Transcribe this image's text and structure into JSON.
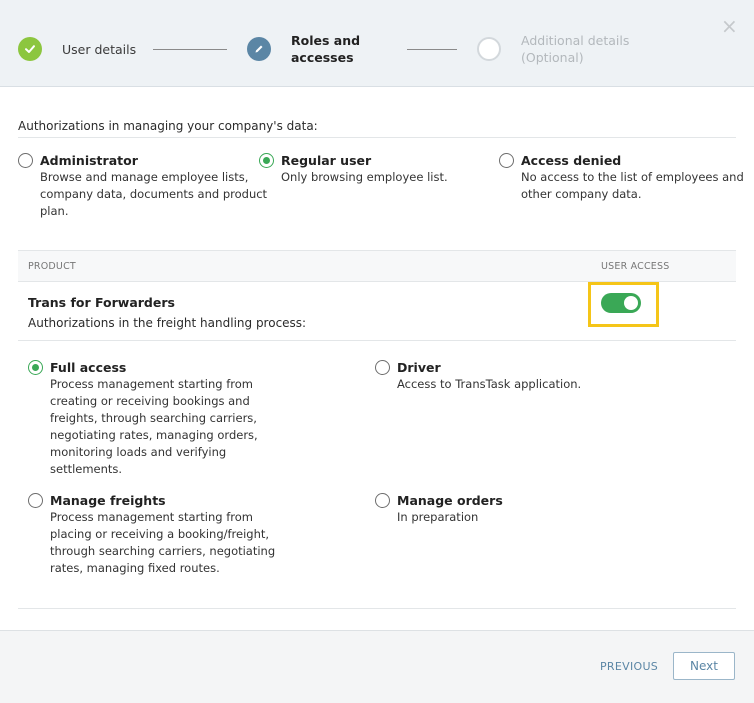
{
  "wizard": {
    "steps": [
      {
        "label_line1": "User details",
        "label_line2": "",
        "state": "done"
      },
      {
        "label_line1": "Roles and",
        "label_line2": "accesses",
        "state": "active"
      },
      {
        "label_line1": "Additional details",
        "label_line2": "(Optional)",
        "state": "todo"
      }
    ],
    "close_symbol": "×"
  },
  "company": {
    "heading": "Authorizations in managing your company's data:",
    "options": [
      {
        "title": "Administrator",
        "description": [
          "Browse and manage employee lists,",
          "company data, documents and product",
          "plan."
        ],
        "selected": false
      },
      {
        "title": "Regular user",
        "description": [
          "Only browsing employee list."
        ],
        "selected": true
      },
      {
        "title": "Access denied",
        "description": [
          "No access to the list of employees and",
          "other company data."
        ],
        "selected": false
      }
    ]
  },
  "products_table": {
    "col_product": "PRODUCT",
    "col_access": "USER ACCESS",
    "product": {
      "name": "Trans for Forwarders",
      "subtitle": "Authorizations in the freight handling process:",
      "access_enabled": true,
      "options": [
        {
          "title": "Full access",
          "description": [
            "Process management starting from",
            "creating or receiving bookings and",
            "freights, through searching carriers,",
            "negotiating rates, managing orders,",
            "monitoring loads and verifying",
            "settlements."
          ],
          "selected": true
        },
        {
          "title": "Driver",
          "description": [
            "Access to TransTask application."
          ],
          "selected": false
        },
        {
          "title": "Manage freights",
          "description": [
            "Process management starting from",
            "placing or receiving a booking/freight,",
            "through searching carriers, negotiating",
            "rates, managing fixed routes."
          ],
          "selected": false
        },
        {
          "title": "Manage orders",
          "description": [
            "In preparation"
          ],
          "selected": false
        }
      ]
    }
  },
  "footer": {
    "previous_label": "PREVIOUS",
    "next_label": "Next"
  },
  "colors": {
    "done_step": "#8cc63f",
    "active_step": "#5b86a5",
    "selected_radio": "#3aa856",
    "toggle_on": "#3aa856",
    "highlight": "#f5c518"
  }
}
